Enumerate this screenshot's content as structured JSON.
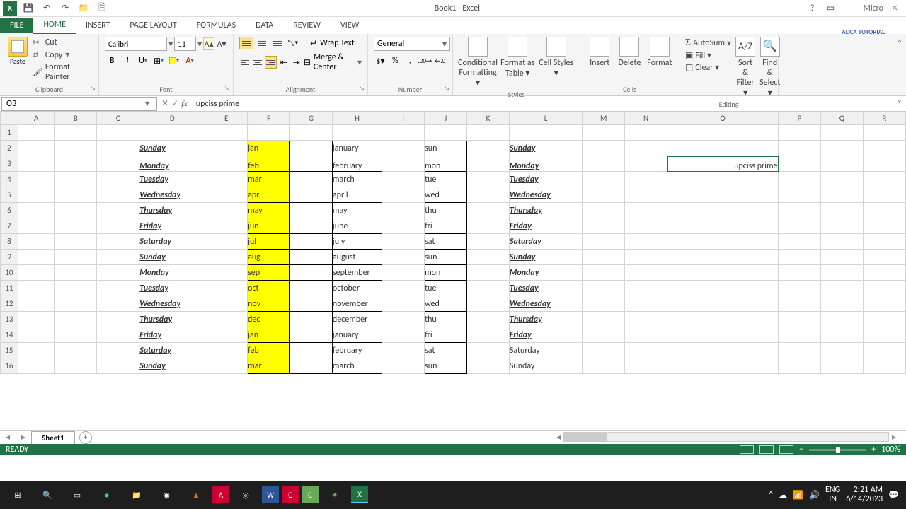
{
  "app": {
    "title": "Book1 - Excel",
    "brand": "Micro"
  },
  "qat": {
    "save": "💾",
    "undo": "↶",
    "redo": "↷",
    "open": "📁",
    "new": "🗎"
  },
  "tabs": {
    "file": "FILE",
    "home": "HOME",
    "insert": "INSERT",
    "pagelayout": "PAGE LAYOUT",
    "formulas": "FORMULAS",
    "data": "DATA",
    "review": "REVIEW",
    "view": "VIEW"
  },
  "ribbon": {
    "clipboard": {
      "label": "Clipboard",
      "paste": "Paste",
      "cut": "Cut",
      "copy": "Copy",
      "painter": "Format Painter"
    },
    "font": {
      "label": "Font",
      "name": "Calibri",
      "size": "11",
      "bold": "B",
      "italic": "I",
      "underline": "U"
    },
    "alignment": {
      "label": "Alignment",
      "wrap": "Wrap Text",
      "merge": "Merge & Center"
    },
    "number": {
      "label": "Number",
      "format": "General"
    },
    "styles": {
      "label": "Styles",
      "cond": "Conditional Formatting ▾",
      "table": "Format as Table ▾",
      "cell": "Cell Styles ▾"
    },
    "cells": {
      "label": "Cells",
      "insert": "Insert",
      "delete": "Delete",
      "format": "Format"
    },
    "editing": {
      "label": "Editing",
      "autosum": "AutoSum",
      "fill": "Fill ▾",
      "clear": "Clear ▾",
      "sort": "Sort & Filter ▾",
      "find": "Find & Select ▾"
    }
  },
  "namebox": "O3",
  "formula": "upciss prime",
  "cols": [
    "A",
    "B",
    "C",
    "D",
    "E",
    "F",
    "G",
    "H",
    "I",
    "J",
    "K",
    "L",
    "M",
    "N",
    "O",
    "P",
    "Q",
    "R"
  ],
  "selected_col": "O",
  "selected_row": 3,
  "cell_O3": "upciss prime",
  "rows": [
    {
      "r": 2,
      "D": "Sunday",
      "F": "jan",
      "H": "january",
      "J": "sun",
      "L": "Sunday",
      "tall": false
    },
    {
      "r": 3,
      "D": "Monday",
      "F": "feb",
      "H": "february",
      "J": "mon",
      "L": "Monday",
      "tall": true
    },
    {
      "r": 4,
      "D": "Tuesday",
      "F": "mar",
      "H": "march",
      "J": "tue",
      "L": "Tuesday"
    },
    {
      "r": 5,
      "D": "Wednesday",
      "F": "apr",
      "H": "april",
      "J": "wed",
      "L": "Wednesday"
    },
    {
      "r": 6,
      "D": "Thursday",
      "F": "may",
      "H": "may",
      "J": "thu",
      "L": "Thursday"
    },
    {
      "r": 7,
      "D": "Friday",
      "F": "jun",
      "H": "june",
      "J": "fri",
      "L": "Friday"
    },
    {
      "r": 8,
      "D": "Saturday",
      "F": "jul",
      "H": "july",
      "J": "sat",
      "L": "Saturday"
    },
    {
      "r": 9,
      "D": "Sunday",
      "F": "aug",
      "H": "august",
      "J": "sun",
      "L": "Sunday"
    },
    {
      "r": 10,
      "D": "Monday",
      "F": "sep",
      "H": "september",
      "J": "mon",
      "L": "Monday"
    },
    {
      "r": 11,
      "D": "Tuesday",
      "F": "oct",
      "H": "october",
      "J": "tue",
      "L": "Tuesday"
    },
    {
      "r": 12,
      "D": "Wednesday",
      "F": "nov",
      "H": "november",
      "J": "wed",
      "L": "Wednesday"
    },
    {
      "r": 13,
      "D": "Thursday",
      "F": "dec",
      "H": "december",
      "J": "thu",
      "L": "Thursday"
    },
    {
      "r": 14,
      "D": "Friday",
      "F": "jan",
      "H": "january",
      "J": "fri",
      "L": "Friday"
    },
    {
      "r": 15,
      "D": "Saturday",
      "F": "feb",
      "H": "february",
      "J": "sat",
      "L": "Saturday",
      "plainL": true
    },
    {
      "r": 16,
      "D": "Sunday",
      "F": "mar",
      "H": "march",
      "J": "sun",
      "L": "Sunday",
      "plainL": true
    }
  ],
  "sheet": "Sheet1",
  "status": "READY",
  "zoom": "100%",
  "clock": {
    "time": "2:21 AM",
    "date": "6/14/2023",
    "lang1": "ENG",
    "lang2": "IN"
  },
  "watermark": "ADCA TUTORIAL"
}
